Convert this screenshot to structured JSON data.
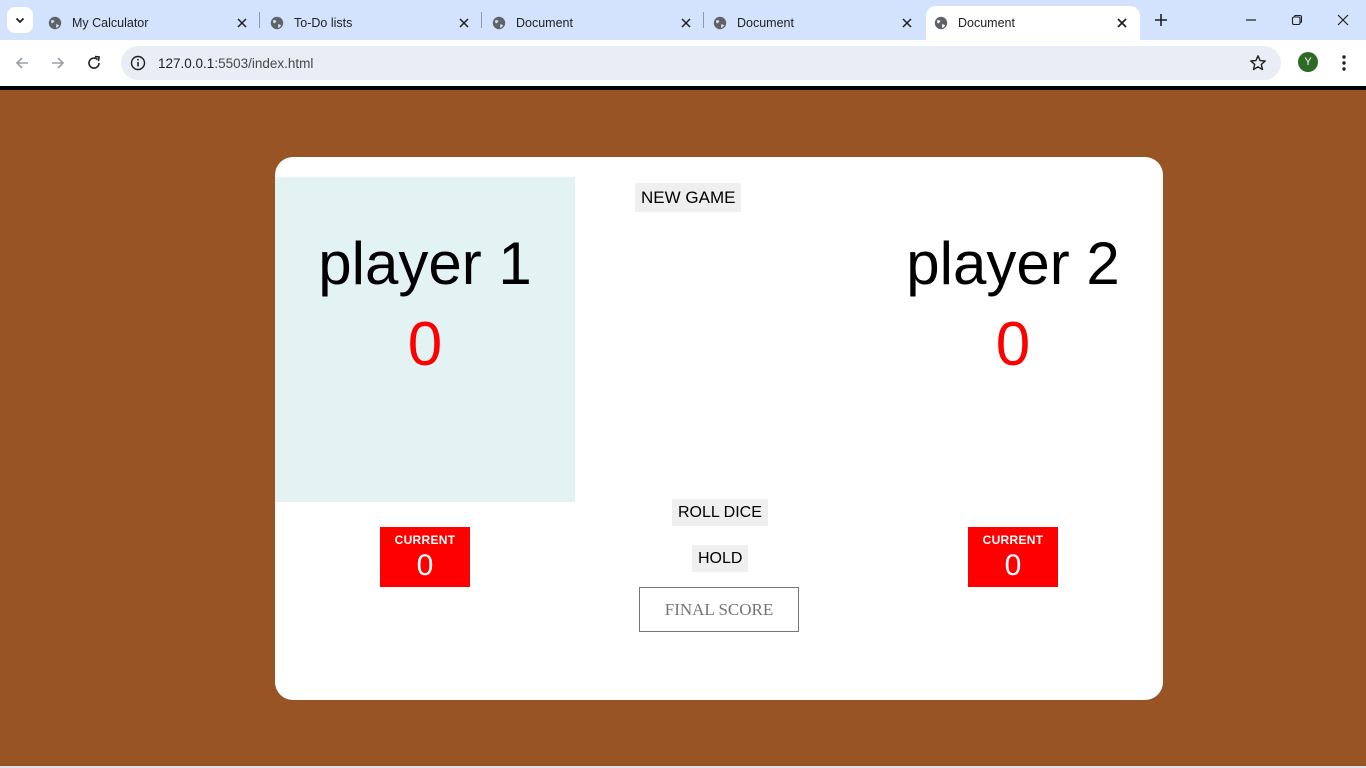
{
  "browser": {
    "tabs": [
      {
        "title": "My Calculator",
        "active": false
      },
      {
        "title": "To-Do lists",
        "active": false
      },
      {
        "title": "Document",
        "active": false
      },
      {
        "title": "Document",
        "active": false
      },
      {
        "title": "Document",
        "active": true
      }
    ],
    "url_host": "127.0.0.1",
    "url_rest": ":5503/index.html",
    "profile_initial": "Y"
  },
  "game": {
    "new_game_label": "NEW GAME",
    "roll_dice_label": "ROLL DICE",
    "hold_label": "HOLD",
    "final_score_placeholder": "FINAL SCORE",
    "players": [
      {
        "name": "player 1",
        "score": "0",
        "current_label": "CURRENT",
        "current_score": "0",
        "active": true
      },
      {
        "name": "player 2",
        "score": "0",
        "current_label": "CURRENT",
        "current_score": "0",
        "active": false
      }
    ]
  },
  "colors": {
    "page_background": "#995426",
    "active_panel": "#e3f3f4",
    "score_red": "#ff0000",
    "current_box": "#ff0000"
  }
}
